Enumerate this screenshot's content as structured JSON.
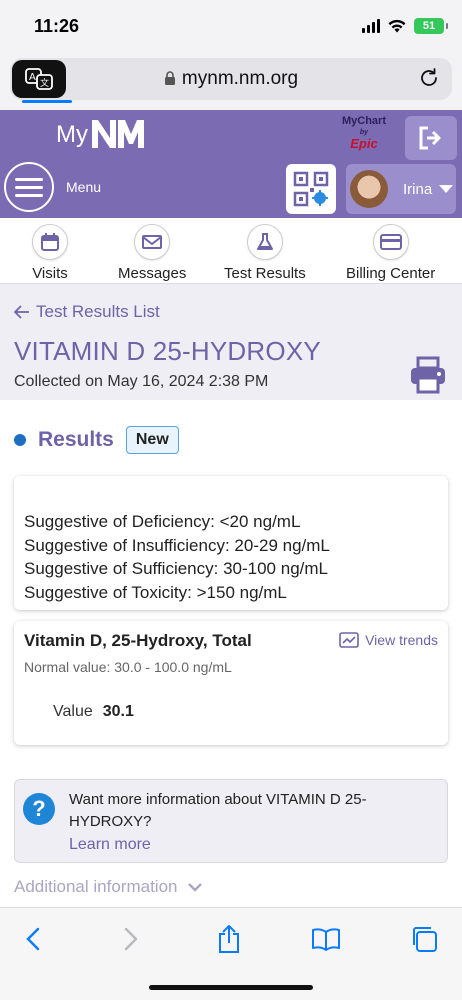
{
  "status_bar": {
    "time": "11:26",
    "battery": "51"
  },
  "browser": {
    "url": "mynm.nm.org"
  },
  "header": {
    "logo_my": "My",
    "mychart_line1": "MyChart",
    "mychart_by": "by",
    "mychart_epic": "Epic",
    "menu_label": "Menu",
    "user_name": "Irina"
  },
  "quick_nav": [
    {
      "label": "Visits",
      "icon": "calendar-icon"
    },
    {
      "label": "Messages",
      "icon": "envelope-icon"
    },
    {
      "label": "Test Results",
      "icon": "flask-icon"
    },
    {
      "label": "Billing Center",
      "icon": "credit-card-icon"
    }
  ],
  "page": {
    "back_label": "Test Results List",
    "title": "VITAMIN D 25-HYDROXY",
    "collected": "Collected on May 16, 2024 2:38 PM"
  },
  "results": {
    "heading": "Results",
    "badge": "New",
    "reference_lines": [
      "Suggestive of Deficiency: <20 ng/mL",
      "Suggestive of Insufficiency: 20-29 ng/mL",
      "Suggestive of Sufficiency: 30-100 ng/mL",
      "Suggestive of Toxicity: >150 ng/mL"
    ],
    "component": {
      "name": "Vitamin D, 25-Hydroxy, Total",
      "view_trends": "View trends",
      "normal_value": "Normal value: 30.0 - 100.0 ng/mL",
      "value_label": "Value",
      "value": "30.1"
    }
  },
  "info": {
    "text": "Want more information about VITAMIN D 25-HYDROXY?",
    "learn_more": "Learn more"
  },
  "additional_info": "Additional information",
  "colors": {
    "brand_purple": "#7b6bb3",
    "link_purple": "#6f63a8",
    "accent_blue": "#1d6fc4"
  }
}
